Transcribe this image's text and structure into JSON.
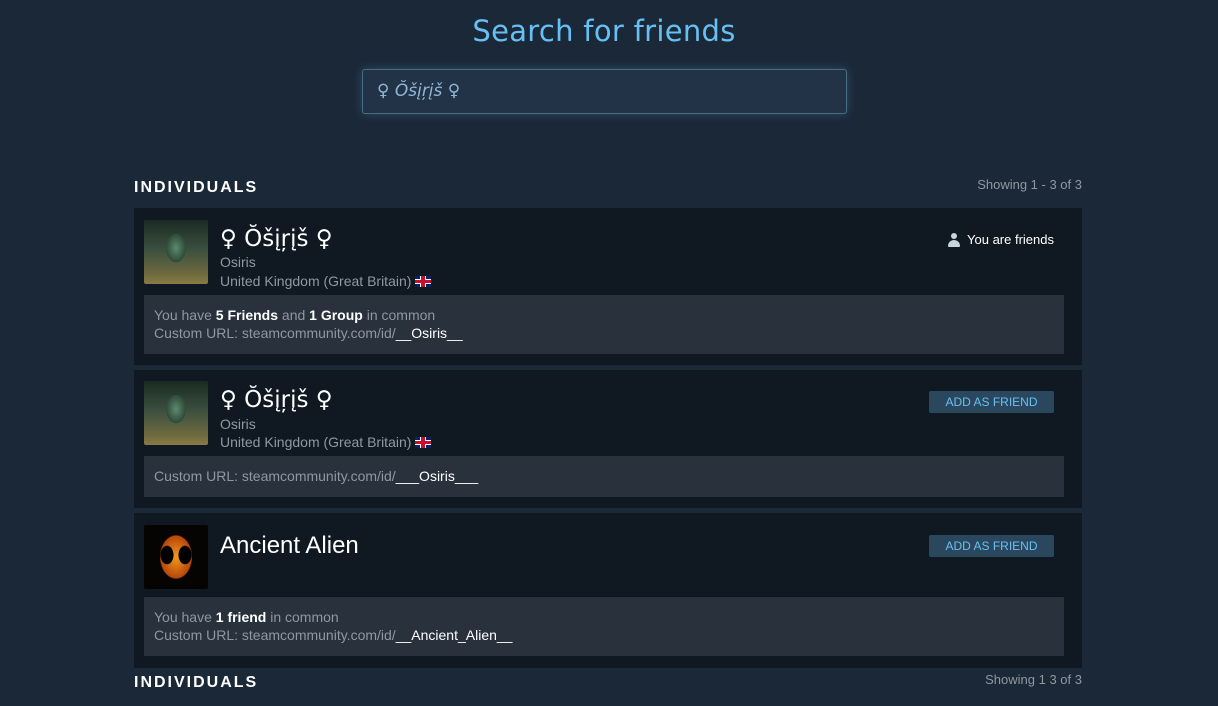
{
  "page": {
    "title": "Search for friends",
    "search_value": "♀ Ŏšįŗįš ♀"
  },
  "sections": [
    {
      "label": "INDIVIDUALS",
      "showing": "Showing 1 - 3 of 3"
    },
    {
      "label": "INDIVIDUALS",
      "showing": "Showing 1   3 of 3"
    }
  ],
  "results": [
    {
      "name": "♀ Ŏšįŗįš ♀",
      "realname": "Osiris",
      "location": "United Kingdom (Great Britain)",
      "status": "You are friends",
      "common_prefix": "You have ",
      "common_friends": "5 Friends",
      "common_and": " and ",
      "common_groups": "1 Group",
      "common_suffix": " in common",
      "url_label": "Custom URL: steamcommunity.com/id/",
      "url_id": "__Osiris__",
      "avatar_icon": "stone-statue-avatar"
    },
    {
      "name": "♀ Ŏšįŗįš ♀",
      "realname": "Osiris",
      "location": "United Kingdom (Great Britain)",
      "action": "ADD AS FRIEND",
      "url_label": "Custom URL: steamcommunity.com/id/",
      "url_id": "___Osiris___",
      "avatar_icon": "stone-statue-avatar"
    },
    {
      "name": "Ancient Alien",
      "action": "ADD AS FRIEND",
      "common_prefix": "You have ",
      "common_friends": "1 friend",
      "common_suffix": " in common",
      "url_label": "Custom URL: steamcommunity.com/id/",
      "url_id": "__Ancient_Alien__",
      "avatar_icon": "alien-face-avatar"
    }
  ],
  "colors": {
    "background": "#1b2838",
    "accent": "#66c0f4",
    "card": "#101822",
    "info_box": "#28313c",
    "button": "#2a475e"
  }
}
